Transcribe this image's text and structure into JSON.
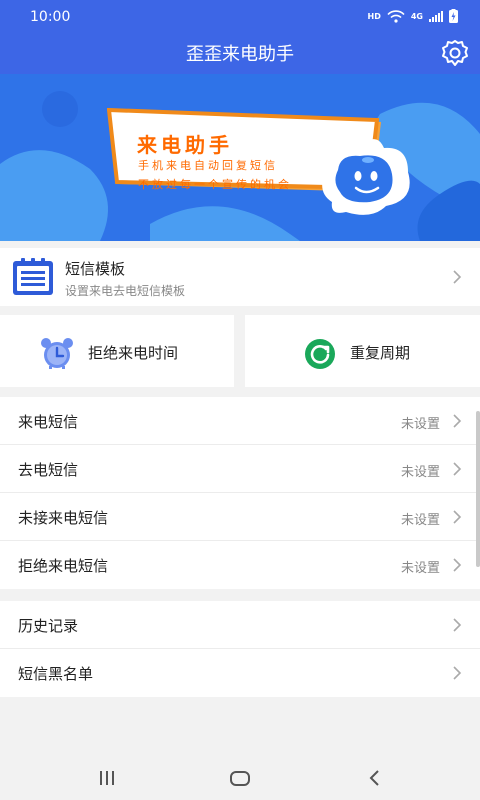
{
  "status_bar": {
    "time": "10:00",
    "hd": "HD",
    "network": "4G"
  },
  "app_bar": {
    "title": "歪歪来电助手",
    "settings_icon": "gear-icon"
  },
  "banner": {
    "title": "来电助手",
    "line1": "手机来电自动回复短信",
    "line2": "不放过每一个宣传的机会",
    "colors": {
      "background": "#2f73e8",
      "accent": "#ff6a00"
    }
  },
  "template_card": {
    "title": "短信模板",
    "subtitle": "设置来电去电短信模板",
    "icon": "clipboard-list-icon"
  },
  "quick_actions": [
    {
      "label": "拒绝来电时间",
      "icon": "alarm-clock-icon"
    },
    {
      "label": "重复周期",
      "icon": "refresh-icon"
    }
  ],
  "sms_settings": [
    {
      "label": "来电短信",
      "value": "未设置"
    },
    {
      "label": "去电短信",
      "value": "未设置"
    },
    {
      "label": "未接来电短信",
      "value": "未设置"
    },
    {
      "label": "拒绝来电短信",
      "value": "未设置"
    }
  ],
  "other_items": [
    {
      "label": "历史记录"
    },
    {
      "label": "短信黑名单"
    }
  ],
  "nav_bar": {
    "buttons": [
      "recent-apps-icon",
      "home-icon",
      "back-icon"
    ]
  },
  "theme": {
    "primary": "#3d66e6",
    "background": "#f2f2f2"
  }
}
